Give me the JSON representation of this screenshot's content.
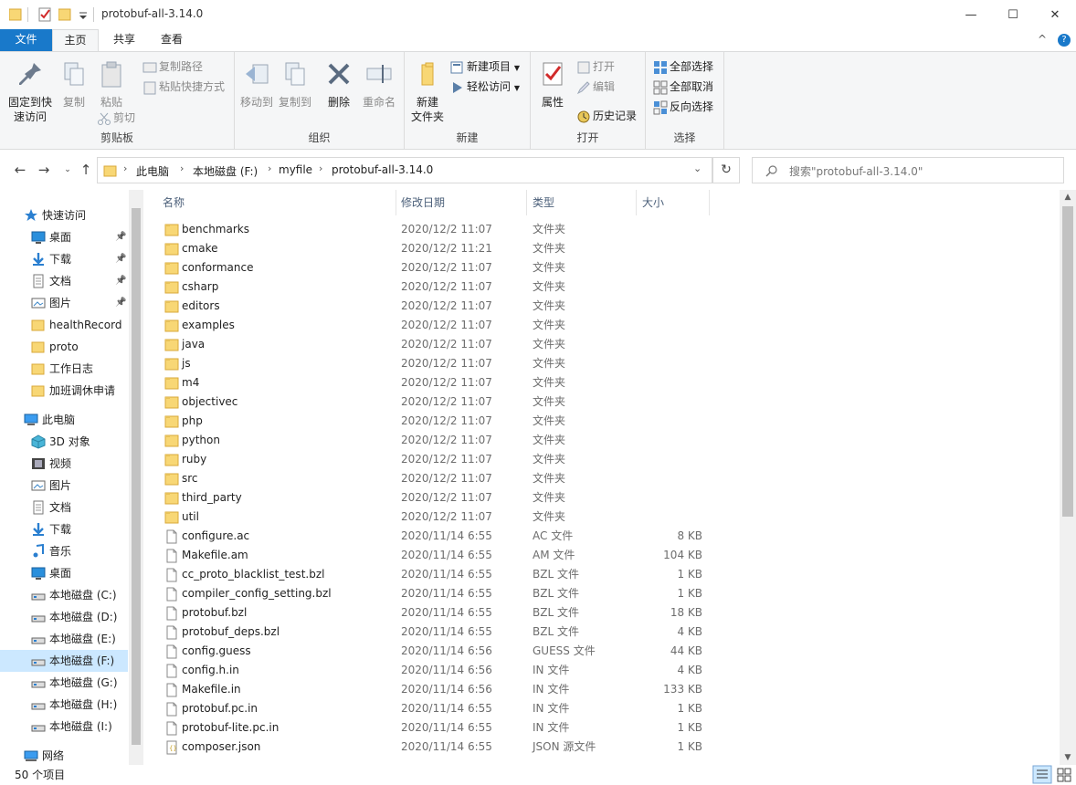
{
  "window": {
    "title": "protobuf-all-3.14.0",
    "minimize_glyph": "—",
    "maximize_glyph": "☐",
    "close_glyph": "✕",
    "help_glyph": "?",
    "collapse_glyph": "^"
  },
  "tabs": [
    {
      "label": "文件"
    },
    {
      "label": "主页"
    },
    {
      "label": "共享"
    },
    {
      "label": "查看"
    }
  ],
  "ribbon": {
    "clipboard": {
      "pin_label": "固定到快速访问",
      "copy_label": "复制",
      "paste_label": "粘贴",
      "copy_path_label": "复制路径",
      "paste_shortcut_label": "粘贴快捷方式",
      "cut_label": "剪切",
      "group_label": "剪贴板"
    },
    "organize": {
      "move_to_label": "移动到",
      "copy_to_label": "复制到",
      "delete_label": "删除",
      "rename_label": "重命名",
      "group_label": "组织"
    },
    "new": {
      "new_folder_label": "新建\n文件夹",
      "new_item_label": "新建项目",
      "easy_access_label": "轻松访问",
      "group_label": "新建"
    },
    "open": {
      "properties_label": "属性",
      "open_label": "打开",
      "edit_label": "编辑",
      "history_label": "历史记录",
      "group_label": "打开"
    },
    "select": {
      "select_all_label": "全部选择",
      "select_none_label": "全部取消",
      "invert_label": "反向选择",
      "group_label": "选择"
    }
  },
  "address": {
    "crumbs": [
      "此电脑",
      "本地磁盘 (F:)",
      "myfile",
      "protobuf-all-3.14.0"
    ],
    "search_placeholder": "搜索\"protobuf-all-3.14.0\""
  },
  "nav": {
    "quick_access": "快速访问",
    "pinned": [
      {
        "label": "桌面",
        "icon": "desktop-icon"
      },
      {
        "label": "下载",
        "icon": "download-icon"
      },
      {
        "label": "文档",
        "icon": "document-icon"
      },
      {
        "label": "图片",
        "icon": "picture-icon"
      }
    ],
    "folders": [
      {
        "label": "healthRecord"
      },
      {
        "label": "proto"
      },
      {
        "label": "工作日志"
      },
      {
        "label": "加班调休申请"
      }
    ],
    "this_pc": "此电脑",
    "pc_items": [
      {
        "label": "3D 对象",
        "icon": "3d-objects-icon"
      },
      {
        "label": "视频",
        "icon": "video-icon"
      },
      {
        "label": "图片",
        "icon": "picture-icon"
      },
      {
        "label": "文档",
        "icon": "document-icon"
      },
      {
        "label": "下载",
        "icon": "download-icon"
      },
      {
        "label": "音乐",
        "icon": "music-icon"
      },
      {
        "label": "桌面",
        "icon": "desktop-icon"
      },
      {
        "label": "本地磁盘 (C:)",
        "icon": "drive-icon"
      },
      {
        "label": "本地磁盘 (D:)",
        "icon": "drive-icon"
      },
      {
        "label": "本地磁盘 (E:)",
        "icon": "drive-icon"
      },
      {
        "label": "本地磁盘 (F:)",
        "icon": "drive-icon",
        "selected": true
      },
      {
        "label": "本地磁盘 (G:)",
        "icon": "drive-icon"
      },
      {
        "label": "本地磁盘 (H:)",
        "icon": "drive-icon"
      },
      {
        "label": "本地磁盘 (I:)",
        "icon": "drive-icon"
      }
    ],
    "network": "网络"
  },
  "columns": {
    "name": "名称",
    "date": "修改日期",
    "type": "类型",
    "size": "大小"
  },
  "files": [
    {
      "name": "benchmarks",
      "date": "2020/12/2 11:07",
      "type": "文件夹",
      "size": "",
      "kind": "folder"
    },
    {
      "name": "cmake",
      "date": "2020/12/2 11:21",
      "type": "文件夹",
      "size": "",
      "kind": "folder"
    },
    {
      "name": "conformance",
      "date": "2020/12/2 11:07",
      "type": "文件夹",
      "size": "",
      "kind": "folder"
    },
    {
      "name": "csharp",
      "date": "2020/12/2 11:07",
      "type": "文件夹",
      "size": "",
      "kind": "folder"
    },
    {
      "name": "editors",
      "date": "2020/12/2 11:07",
      "type": "文件夹",
      "size": "",
      "kind": "folder"
    },
    {
      "name": "examples",
      "date": "2020/12/2 11:07",
      "type": "文件夹",
      "size": "",
      "kind": "folder"
    },
    {
      "name": "java",
      "date": "2020/12/2 11:07",
      "type": "文件夹",
      "size": "",
      "kind": "folder"
    },
    {
      "name": "js",
      "date": "2020/12/2 11:07",
      "type": "文件夹",
      "size": "",
      "kind": "folder"
    },
    {
      "name": "m4",
      "date": "2020/12/2 11:07",
      "type": "文件夹",
      "size": "",
      "kind": "folder"
    },
    {
      "name": "objectivec",
      "date": "2020/12/2 11:07",
      "type": "文件夹",
      "size": "",
      "kind": "folder"
    },
    {
      "name": "php",
      "date": "2020/12/2 11:07",
      "type": "文件夹",
      "size": "",
      "kind": "folder"
    },
    {
      "name": "python",
      "date": "2020/12/2 11:07",
      "type": "文件夹",
      "size": "",
      "kind": "folder"
    },
    {
      "name": "ruby",
      "date": "2020/12/2 11:07",
      "type": "文件夹",
      "size": "",
      "kind": "folder"
    },
    {
      "name": "src",
      "date": "2020/12/2 11:07",
      "type": "文件夹",
      "size": "",
      "kind": "folder"
    },
    {
      "name": "third_party",
      "date": "2020/12/2 11:07",
      "type": "文件夹",
      "size": "",
      "kind": "folder"
    },
    {
      "name": "util",
      "date": "2020/12/2 11:07",
      "type": "文件夹",
      "size": "",
      "kind": "folder"
    },
    {
      "name": "configure.ac",
      "date": "2020/11/14 6:55",
      "type": "AC 文件",
      "size": "8 KB",
      "kind": "file"
    },
    {
      "name": "Makefile.am",
      "date": "2020/11/14 6:55",
      "type": "AM 文件",
      "size": "104 KB",
      "kind": "file"
    },
    {
      "name": "cc_proto_blacklist_test.bzl",
      "date": "2020/11/14 6:55",
      "type": "BZL 文件",
      "size": "1 KB",
      "kind": "file"
    },
    {
      "name": "compiler_config_setting.bzl",
      "date": "2020/11/14 6:55",
      "type": "BZL 文件",
      "size": "1 KB",
      "kind": "file"
    },
    {
      "name": "protobuf.bzl",
      "date": "2020/11/14 6:55",
      "type": "BZL 文件",
      "size": "18 KB",
      "kind": "file"
    },
    {
      "name": "protobuf_deps.bzl",
      "date": "2020/11/14 6:55",
      "type": "BZL 文件",
      "size": "4 KB",
      "kind": "file"
    },
    {
      "name": "config.guess",
      "date": "2020/11/14 6:56",
      "type": "GUESS 文件",
      "size": "44 KB",
      "kind": "file"
    },
    {
      "name": "config.h.in",
      "date": "2020/11/14 6:56",
      "type": "IN 文件",
      "size": "4 KB",
      "kind": "file"
    },
    {
      "name": "Makefile.in",
      "date": "2020/11/14 6:56",
      "type": "IN 文件",
      "size": "133 KB",
      "kind": "file"
    },
    {
      "name": "protobuf.pc.in",
      "date": "2020/11/14 6:55",
      "type": "IN 文件",
      "size": "1 KB",
      "kind": "file"
    },
    {
      "name": "protobuf-lite.pc.in",
      "date": "2020/11/14 6:55",
      "type": "IN 文件",
      "size": "1 KB",
      "kind": "file"
    },
    {
      "name": "composer.json",
      "date": "2020/11/14 6:55",
      "type": "JSON 源文件",
      "size": "1 KB",
      "kind": "json"
    }
  ],
  "status": {
    "count_text": "50 个项目"
  },
  "colors": {
    "accent": "#1979ca",
    "folder": "#f8d775",
    "selection": "#cce8ff"
  }
}
